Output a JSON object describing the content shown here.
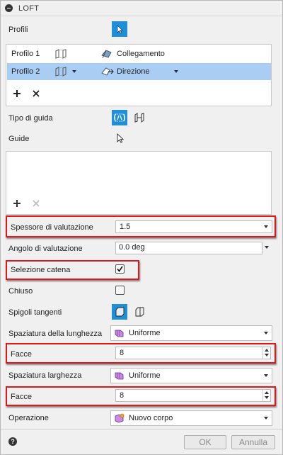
{
  "panel": {
    "title": "LOFT"
  },
  "profili": {
    "label": "Profili",
    "rows": [
      {
        "name": "Profilo 1",
        "condition": "Collegamento"
      },
      {
        "name": "Profilo 2",
        "condition": "Direzione"
      }
    ]
  },
  "tipo_guida": {
    "label": "Tipo di guida"
  },
  "guide": {
    "label": "Guide"
  },
  "spessore": {
    "label": "Spessore di valutazione",
    "value": "1.5"
  },
  "angolo": {
    "label": "Angolo di valutazione",
    "value": "0.0 deg"
  },
  "selezione_catena": {
    "label": "Selezione catena",
    "checked": true
  },
  "chiuso": {
    "label": "Chiuso",
    "checked": false
  },
  "spigoli": {
    "label": "Spigoli tangenti"
  },
  "spaziatura_lunghezza": {
    "label": "Spaziatura della lunghezza",
    "value": "Uniforme"
  },
  "facce_lunghezza": {
    "label": "Facce",
    "value": "8"
  },
  "spaziatura_larghezza": {
    "label": "Spaziatura larghezza",
    "value": "Uniforme"
  },
  "facce_larghezza": {
    "label": "Facce",
    "value": "8"
  },
  "operazione": {
    "label": "Operazione",
    "value": "Nuovo corpo"
  },
  "footer": {
    "help": "?",
    "ok": "OK",
    "cancel": "Annulla"
  },
  "colors": {
    "accent": "#1f90d8",
    "selection": "#aacdf3",
    "highlight": "#e01818"
  }
}
